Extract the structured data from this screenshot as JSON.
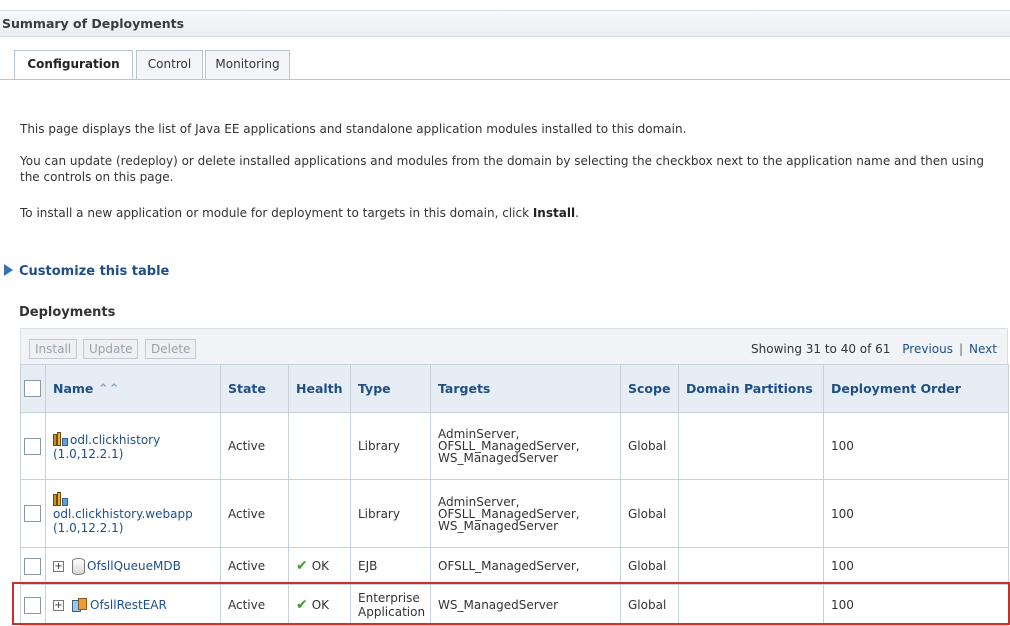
{
  "header": {
    "title": "Summary of Deployments"
  },
  "tabs": [
    {
      "label": "Configuration",
      "active": true
    },
    {
      "label": "Control",
      "active": false
    },
    {
      "label": "Monitoring",
      "active": false
    }
  ],
  "intro": {
    "p1": "This page displays the list of Java EE applications and standalone application modules installed to this domain.",
    "p2": "You can update (redeploy) or delete installed applications and modules from the domain by selecting the checkbox next to the application name and then using the controls on this page.",
    "p3_pre": "To install a new application or module for deployment to targets in this domain, click ",
    "p3_bold": "Install",
    "p3_post": "."
  },
  "customize_label": "Customize this table",
  "deployments": {
    "title": "Deployments",
    "buttons": {
      "install": "Install",
      "update": "Update",
      "delete": "Delete"
    },
    "pager": {
      "showing": "Showing 31 to 40 of 61",
      "previous": "Previous",
      "next": "Next"
    },
    "columns": [
      "Name",
      "State",
      "Health",
      "Type",
      "Targets",
      "Scope",
      "Domain Partitions",
      "Deployment Order"
    ],
    "sort_icon": "chevrons-up-icon",
    "rows": [
      {
        "icon": "library-icon",
        "name": "odl.clickhistory",
        "version": "(1.0,12.2.1)",
        "state": "Active",
        "health": "",
        "type": "Library",
        "targets": [
          "AdminServer,",
          "OFSLL_ManagedServer,",
          "WS_ManagedServer"
        ],
        "scope": "Global",
        "partitions": "",
        "order": "100"
      },
      {
        "icon": "library-icon",
        "name": "odl.clickhistory.webapp",
        "version": "(1.0,12.2.1)",
        "state": "Active",
        "health": "",
        "type": "Library",
        "targets": [
          "AdminServer,",
          "OFSLL_ManagedServer,",
          "WS_ManagedServer"
        ],
        "scope": "Global",
        "partitions": "",
        "order": "100"
      },
      {
        "icon": "ejb-icon",
        "name": "OfsllQueueMDB",
        "state": "Active",
        "health": "OK",
        "type": "EJB",
        "targets": [
          "OFSLL_ManagedServer,"
        ],
        "scope": "Global",
        "partitions": "",
        "order": "100"
      },
      {
        "icon": "ear-icon",
        "name": "OfsllRestEAR",
        "state": "Active",
        "health": "OK",
        "type_line1": "Enterprise",
        "type_line2": "Application",
        "targets": [
          "WS_ManagedServer"
        ],
        "scope": "Global",
        "partitions": "",
        "order": "100"
      }
    ]
  },
  "colors": {
    "link": "#1f4f86",
    "header_bg": "#e6edf5",
    "highlight": "#c9302c",
    "ok_check": "#3a9a2a"
  }
}
